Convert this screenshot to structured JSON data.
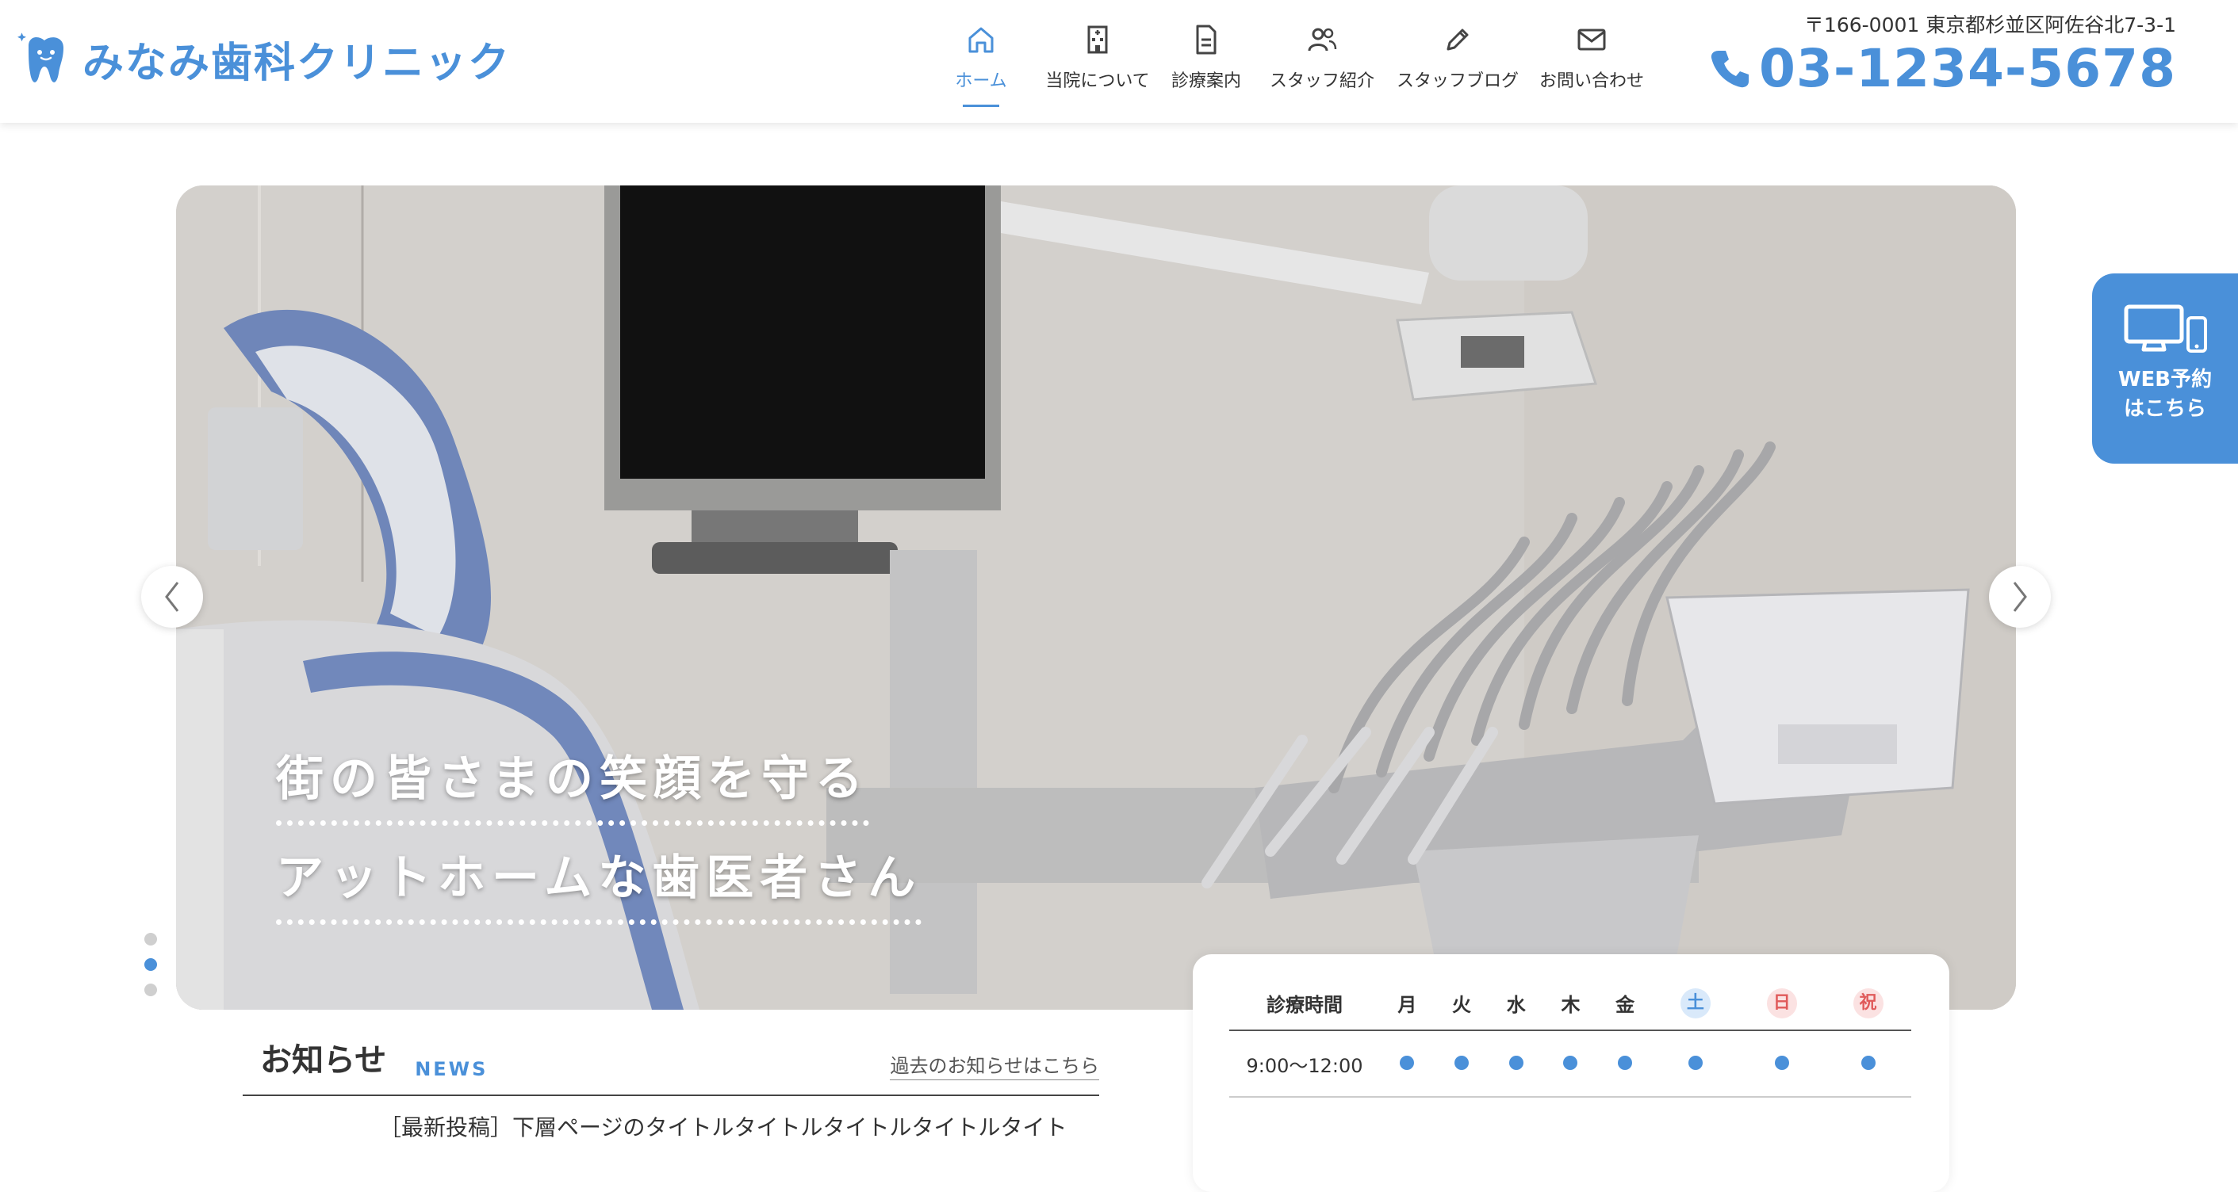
{
  "brand": {
    "name": "みなみ歯科クリニック",
    "logo_icon": "tooth-icon",
    "color": "#4a90d9"
  },
  "nav": {
    "items": [
      {
        "label": "ホーム",
        "icon": "home-icon",
        "active": true
      },
      {
        "label": "当院について",
        "icon": "building-icon"
      },
      {
        "label": "診療案内",
        "icon": "document-icon"
      },
      {
        "label": "スタッフ紹介",
        "icon": "people-icon"
      },
      {
        "label": "スタッフブログ",
        "icon": "pen-icon"
      },
      {
        "label": "お問い合わせ",
        "icon": "mail-icon"
      }
    ]
  },
  "contact": {
    "address": "〒166-0001 東京都杉並区阿佐谷北7-3-1",
    "phone": "03-1234-5678",
    "phone_icon": "phone-icon"
  },
  "hero": {
    "line1": "街の皆さまの笑顔を守る",
    "line2": "アットホームな歯医者さん",
    "slides": 3,
    "active_slide": 2,
    "prev_icon": "chevron-left-icon",
    "next_icon": "chevron-right-icon"
  },
  "web_reserve": {
    "line1": "WEB予約",
    "line2": "はこちら",
    "icon": "devices-icon"
  },
  "news": {
    "title": "お知らせ",
    "title_en": "NEWS",
    "past_link": "過去のお知らせはこちら",
    "items": [
      "［最新投稿］下層ページのタイトルタイトルタイトルタイトルタイト"
    ]
  },
  "schedule": {
    "header": [
      "診療時間",
      "月",
      "火",
      "水",
      "木",
      "金",
      "土",
      "日",
      "祝"
    ],
    "rows": [
      {
        "time": "9:00〜12:00",
        "open": [
          true,
          true,
          true,
          true,
          true,
          true,
          true,
          true
        ]
      }
    ]
  }
}
